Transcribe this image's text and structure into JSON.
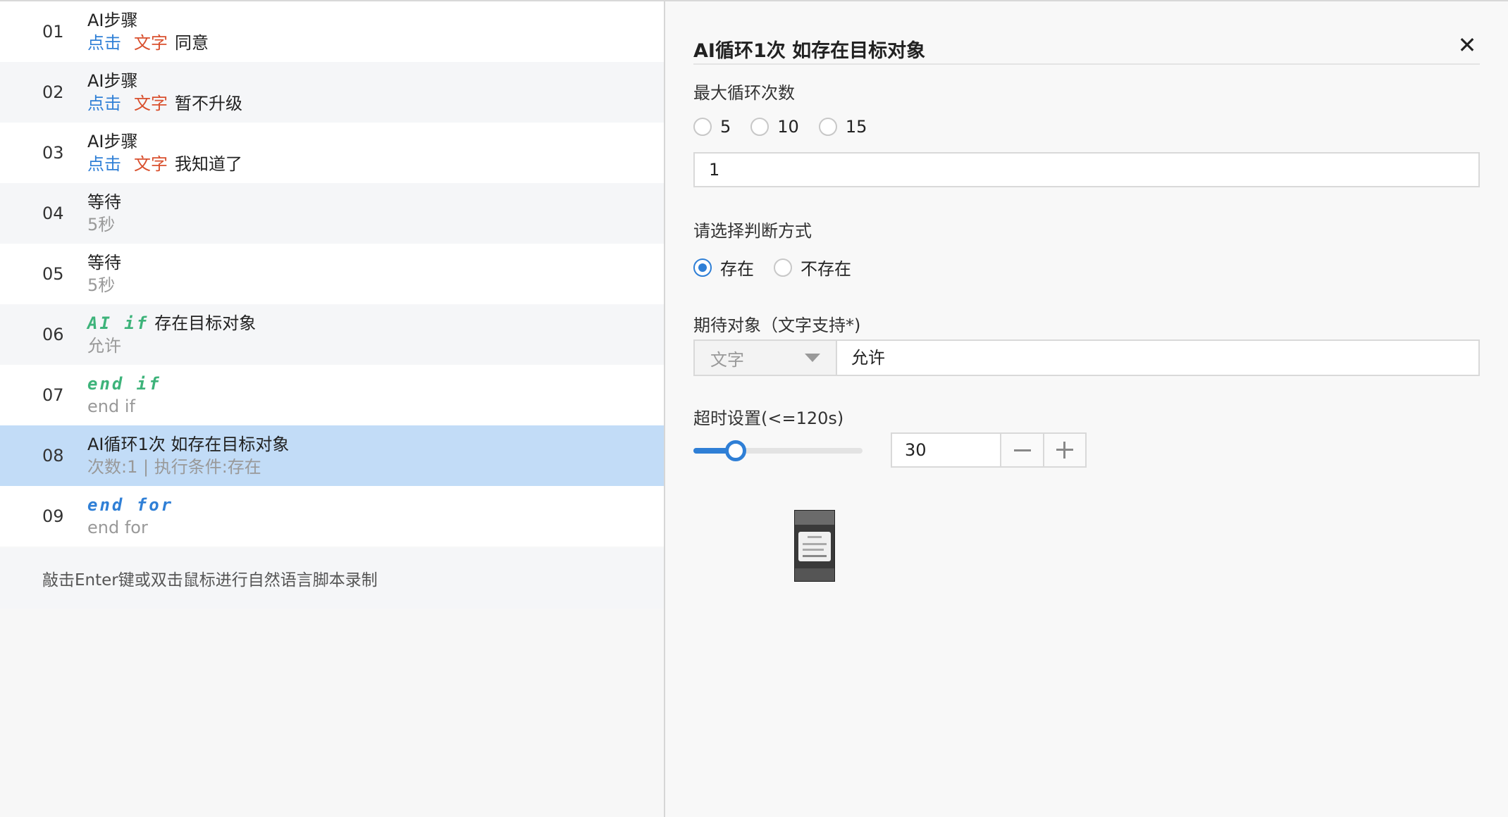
{
  "steps": [
    {
      "num": "01",
      "title": "AI步骤",
      "action": "点击",
      "type": "文字",
      "target": "同意"
    },
    {
      "num": "02",
      "title": "AI步骤",
      "action": "点击",
      "type": "文字",
      "target": "暂不升级"
    },
    {
      "num": "03",
      "title": "AI步骤",
      "action": "点击",
      "type": "文字",
      "target": "我知道了"
    },
    {
      "num": "04",
      "title": "等待",
      "sub": "5秒"
    },
    {
      "num": "05",
      "title": "等待",
      "sub": "5秒"
    },
    {
      "num": "06",
      "keyword": "AI if",
      "title": "存在目标对象",
      "sub": "允许"
    },
    {
      "num": "07",
      "keyword": "end if",
      "sub": "end if"
    },
    {
      "num": "08",
      "title": "AI循环1次 如存在目标对象",
      "sub": "次数:1 | 执行条件:存在"
    },
    {
      "num": "09",
      "keyword": "end for",
      "sub": "end for"
    }
  ],
  "hint": "敲击Enter键或双击鼠标进行自然语言脚本录制",
  "panel": {
    "title": "AI循环1次 如存在目标对象",
    "close_symbol": "✕",
    "max_loop_label": "最大循环次数",
    "loop_options": [
      "5",
      "10",
      "15"
    ],
    "loop_value": "1",
    "judge_label": "请选择判断方式",
    "judge_options": [
      "存在",
      "不存在"
    ],
    "judge_selected": "存在",
    "expect_label": "期待对象（文字支持*)",
    "expect_type": "文字",
    "expect_value": "允许",
    "timeout_label": "超时设置(<=120s)",
    "timeout_value": "30",
    "timeout_max": "120"
  },
  "colors": {
    "accent": "#2f7fd6",
    "keyword_green": "#3db37a",
    "type_red": "#d9502e",
    "selected_row": "#c2dcf7"
  }
}
